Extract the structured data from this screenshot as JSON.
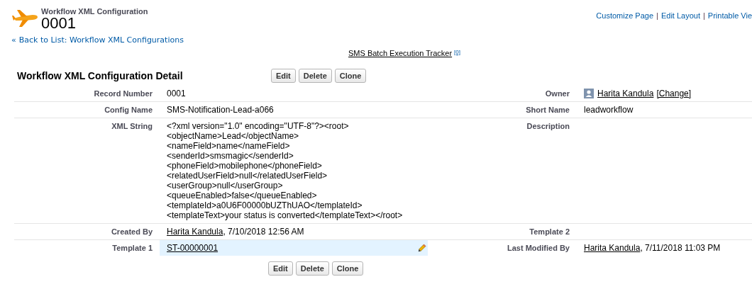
{
  "header": {
    "object_type": "Workflow XML Configuration",
    "record_name": "0001"
  },
  "top_links": [
    {
      "kind": "link",
      "text": "Customize Page"
    },
    {
      "kind": "separator",
      "text": "|"
    },
    {
      "kind": "link",
      "text": "Edit Layout"
    },
    {
      "kind": "separator",
      "text": "|"
    },
    {
      "kind": "link",
      "text": "Printable Vie"
    }
  ],
  "back_link": {
    "prefix": "«",
    "text": "Back to List: Workflow XML Configurations"
  },
  "related_link": {
    "text": "SMS Batch Execution Tracker",
    "count": "[0]"
  },
  "detail": {
    "title": "Workflow XML Configuration Detail",
    "top_buttons": [
      "Edit",
      "Delete",
      "Clone"
    ],
    "rows": [
      {
        "left": {
          "label": "Record Number",
          "hovered": false,
          "parts": [
            {
              "kind": "plain",
              "text": "0001"
            }
          ]
        },
        "right": {
          "label": "Owner",
          "hovered": false,
          "parts": [
            {
              "kind": "avatar"
            },
            {
              "kind": "link",
              "text": "Harita Kandula"
            },
            {
              "kind": "link",
              "text": "[Change]"
            }
          ]
        }
      },
      {
        "left": {
          "label": "Config Name",
          "hovered": false,
          "parts": [
            {
              "kind": "plain",
              "text": "SMS-Notification-Lead-a066"
            }
          ]
        },
        "right": {
          "label": "Short Name",
          "hovered": false,
          "parts": [
            {
              "kind": "plain",
              "text": "leadworkflow"
            }
          ]
        }
      },
      {
        "left": {
          "label": "XML String",
          "hovered": false,
          "lines": [
            "<?xml version=\"1.0\" encoding=\"UTF-8\"?><root>",
            "<objectName>Lead</objectName>",
            "<nameField>name</nameField>",
            "<senderId>smsmagic</senderId>",
            "<phoneField>mobilephone</phoneField>",
            "<relatedUserField>null</relatedUserField>",
            "<userGroup>null</userGroup>",
            "<queueEnabled>false</queueEnabled>",
            "<templateId>a0U6F00000bUZThUAO</templateId>",
            "<templateText>your status is converted</templateText></root>"
          ]
        },
        "right": {
          "label": "Description",
          "hovered": false
        }
      },
      {
        "left": {
          "label": "Created By",
          "hovered": false,
          "parts": [
            {
              "kind": "link",
              "text": "Harita Kandula"
            },
            {
              "kind": "plain",
              "text": ", 7/10/2018 12:56 AM"
            }
          ]
        },
        "right": {
          "label": "Template 2",
          "hovered": false
        }
      },
      {
        "left": {
          "label": "Template 1",
          "hovered": true,
          "parts": [
            {
              "kind": "link",
              "text": "ST-00000001"
            }
          ]
        },
        "right": {
          "label": "Last Modified By",
          "hovered": false,
          "parts": [
            {
              "kind": "link",
              "text": "Harita Kandula"
            },
            {
              "kind": "plain",
              "text": ", 7/11/2018 11:03 PM"
            }
          ]
        }
      }
    ],
    "bottom_buttons": [
      "Edit",
      "Delete",
      "Clone"
    ]
  }
}
